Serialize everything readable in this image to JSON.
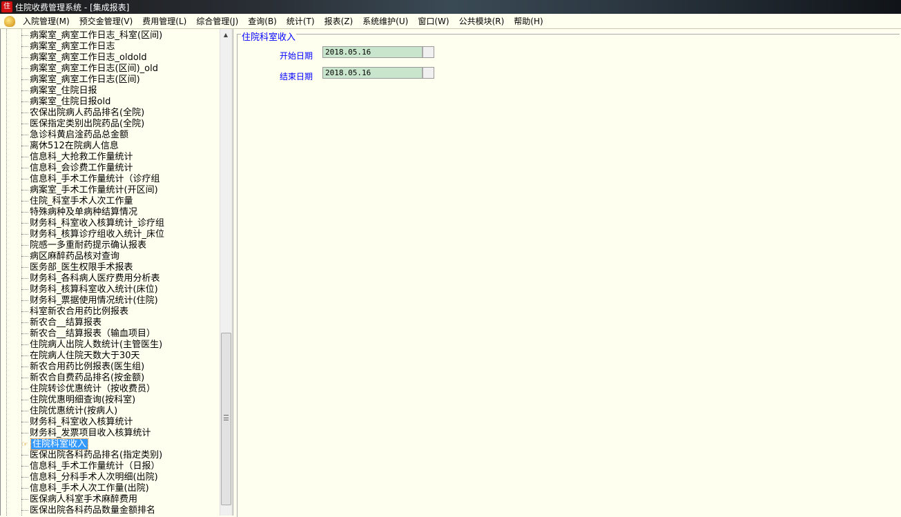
{
  "window": {
    "title": "住院收费管理系统 - [集成报表]",
    "icon_text": "住"
  },
  "menu": [
    "入院管理(M)",
    "预交金管理(V)",
    "费用管理(L)",
    "综合管理(J)",
    "查询(B)",
    "统计(T)",
    "报表(Z)",
    "系统维护(U)",
    "窗口(W)",
    "公共模块(R)",
    "帮助(H)"
  ],
  "tree": {
    "selected_index": 37,
    "items": [
      "病案室_病室工作日志_科室(区间)",
      "病案室_病室工作日志",
      "病案室_病室工作日志_oldold",
      "病案室_病室工作日志(区间)_old",
      "病案室_病室工作日志(区间)",
      "病案室_住院日报",
      "病案室_住院日报old",
      "农保出院病人药品排名(全院)",
      "医保指定类别出院药品(全院)",
      "急诊科黄启淦药品总金额",
      "离休512在院病人信息",
      "信息科_大抢救工作量统计",
      "信息科_会诊费工作量统计",
      "信息科_手术工作量统计（诊疗组",
      "病案室_手术工作量统计(开区间)",
      "住院_科室手术人次工作量",
      "特殊病种及单病种结算情况",
      "财务科_科室收入核算统计_诊疗组",
      "财务科_核算诊疗组收入统计_床位",
      "院感一多重耐药提示确认报表",
      "病区麻醉药品核对查询",
      "医务部_医生权限手术报表",
      "财务科_各科病人医疗费用分析表",
      "财务科_核算科室收入统计(床位)",
      "财务科_票据使用情况统计(住院)",
      "科室新农合用药比例报表",
      "新农合__结算报表",
      "新农合__结算报表（输血项目）",
      "住院病人出院人数统计(主管医生)",
      "在院病人住院天数大于30天",
      "新农合用药比例报表(医生组)",
      "新农合自费药品排名(按金额)",
      "住院转诊优惠统计（按收费员）",
      "住院优惠明细查询(按科室)",
      "住院优惠统计(按病人)",
      "财务科_科室收入核算统计",
      "财务科_发票项目收入核算统计",
      "住院科室收入",
      "医保出院各科药品排名(指定类别)",
      "信息科_手术工作量统计（日报）",
      "信息科_分科手术人次明细(出院)",
      "信息科_手术人次工作量(出院)",
      "医保病人科室手术麻醉费用",
      "医保出院各科药品数量金额排名"
    ]
  },
  "form": {
    "title": "住院科室收入",
    "start_label": "开始日期",
    "start_value": "2018.05.16",
    "end_label": "结束日期",
    "end_value": "2018.05.16"
  }
}
